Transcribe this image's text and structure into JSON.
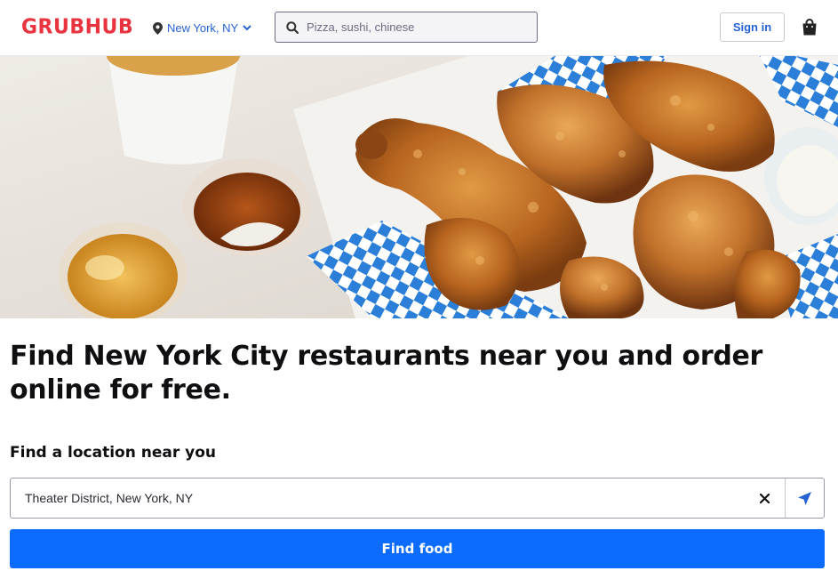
{
  "header": {
    "logo": "GRUBHUB",
    "location": "New York, NY",
    "search_placeholder": "Pizza, sushi, chinese",
    "signin_label": "Sign in"
  },
  "hero": {
    "image_description_icon": "fried-chicken-photo"
  },
  "main": {
    "headline": "Find New York City restaurants near you and order online for free.",
    "location_prompt": "Find a location near you",
    "address_value": "Theater District, New York, NY",
    "find_button_label": "Find food"
  },
  "colors": {
    "brand_red": "#e8343f",
    "link_blue": "#2762d4",
    "button_blue": "#0b6cff"
  },
  "icons": {
    "location": "map-pin-icon",
    "chevron": "chevron-down-icon",
    "search": "search-icon",
    "bag": "shopping-bag-icon",
    "clear": "close-icon",
    "locate": "navigation-arrow-icon"
  }
}
